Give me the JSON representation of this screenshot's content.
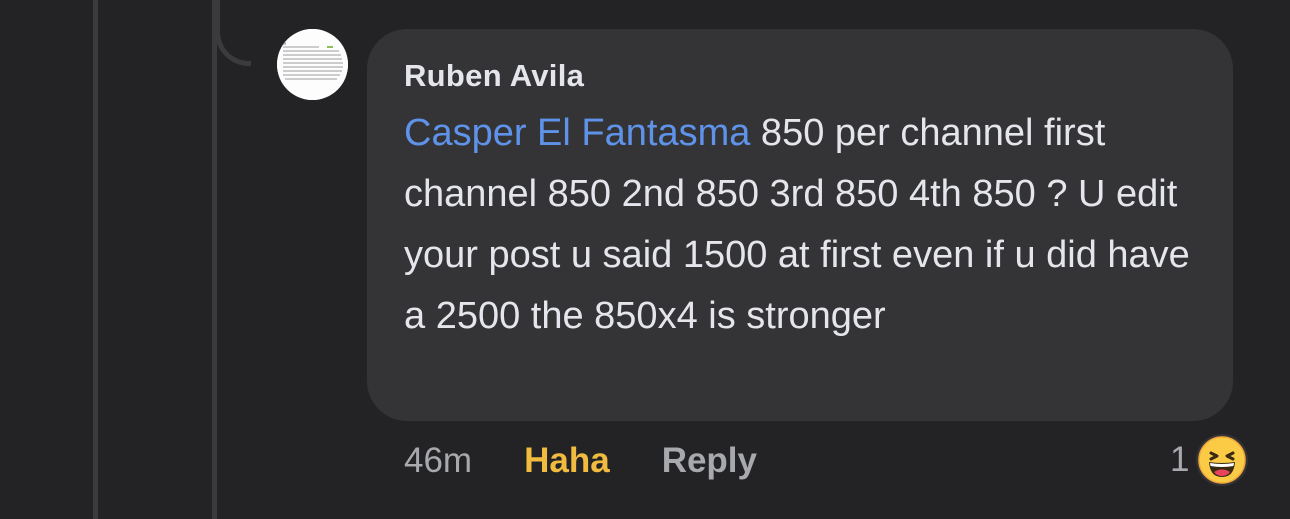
{
  "comment": {
    "author": "Ruben Avila",
    "mention": "Casper El Fantasma",
    "text": " 850 per channel first channel 850 2nd 850 3rd 850 4th 850 ? U edit your post u said 1500 at first even if u did have a 2500 the 850x4 is stronger",
    "timestamp": "46m",
    "reaction_label": "Haha",
    "reply_label": "Reply",
    "reaction_count": "1",
    "reaction_icon": "haha-emoji-icon",
    "avatar_icon": "profile-photo-icon"
  },
  "colors": {
    "background": "#232325",
    "bubble": "#343436",
    "mention": "#5f93ea",
    "reaction_active": "#f1bb3f",
    "muted": "#a7a9ad",
    "text": "#e4e6eb"
  }
}
